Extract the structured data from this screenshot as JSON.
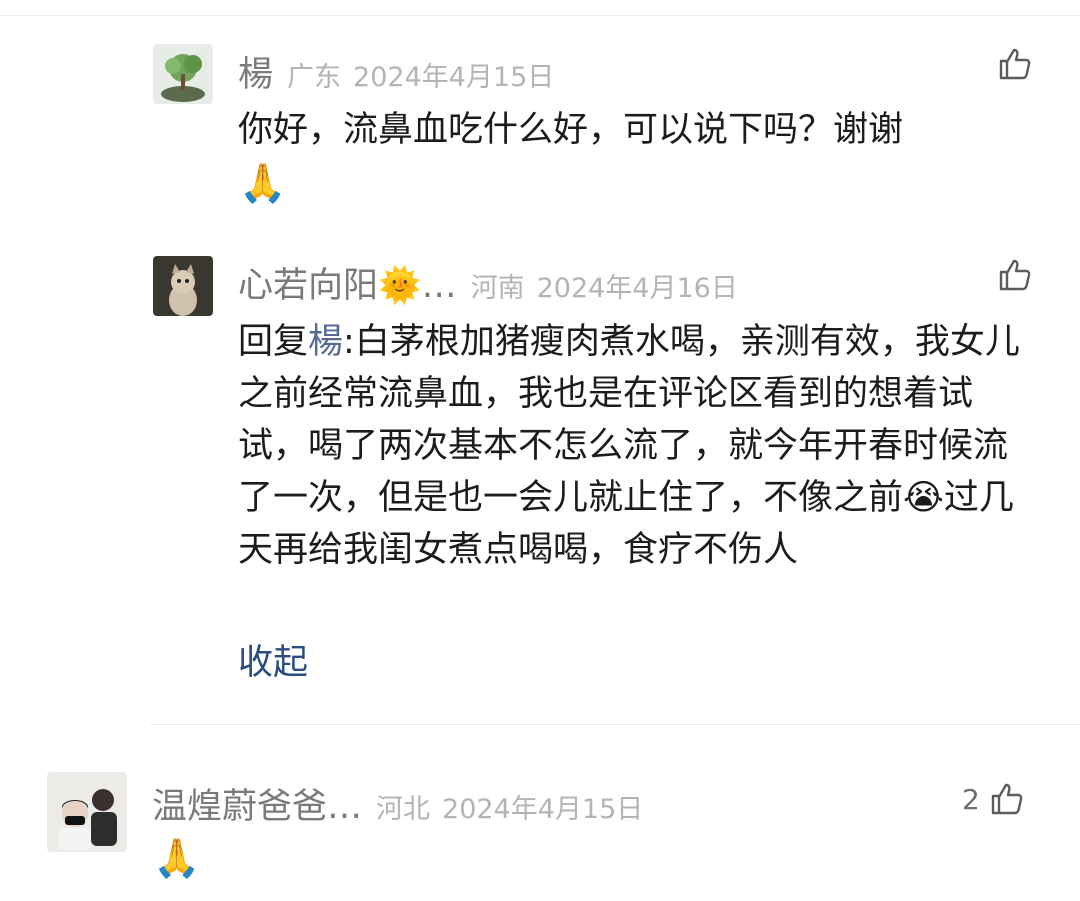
{
  "comments": [
    {
      "nickname": "楊",
      "region": "广东",
      "date": "2024年4月15日",
      "text": "你好，流鼻血吃什么好，可以说下吗？谢谢",
      "trailing_emoji": "🙏"
    },
    {
      "nickname": "心若向阳🌞…",
      "region": "河南",
      "date": "2024年4月16日",
      "reply_prefix": "回复",
      "reply_to": "楊",
      "reply_colon": ":",
      "text_part1": "白茅根加猪瘦肉煮水喝，亲测有效，我女儿之前经常流鼻血，我也是在评论区看到的想着试试，喝了两次基本不怎么流了，就今年开春时候流了一次，但是也一会儿就止住了，不像之前",
      "inline_emoji": "😭",
      "text_part2": "过几天再给我闺女煮点喝喝，食疗不伤人",
      "collapse_label": "收起"
    },
    {
      "nickname": "温煌蔚爸爸…",
      "region": "河北",
      "date": "2024年4月15日",
      "like_count": "2",
      "trailing_emoji": "🙏"
    }
  ],
  "icons": {
    "like": "thumbs-up-icon"
  },
  "colors": {
    "link": "#2a4c80",
    "mention": "#576b95",
    "meta_gray": "#b4b4b4"
  }
}
